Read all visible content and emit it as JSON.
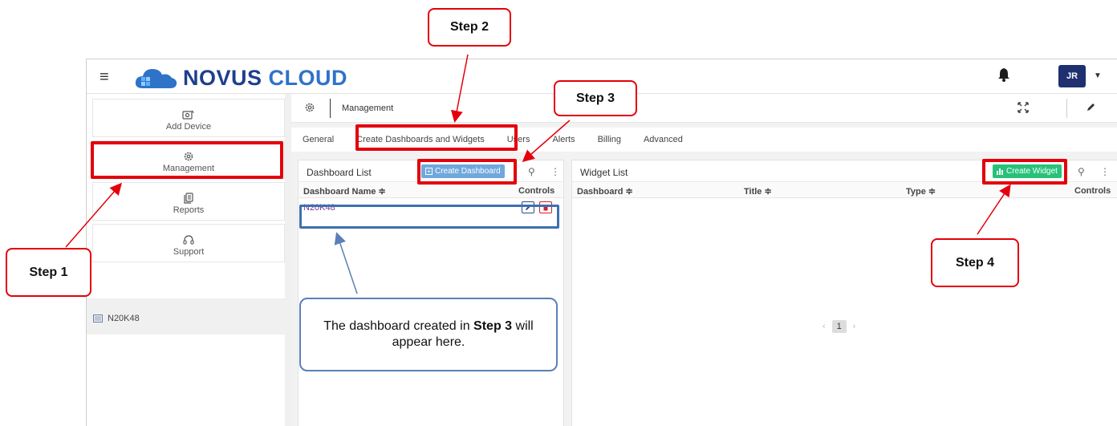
{
  "app": {
    "logo_word1": "novus",
    "logo_word2": "cloud",
    "user_initials": "JR"
  },
  "sidebar": {
    "items": [
      {
        "label": "Add Device",
        "icon": "device-icon"
      },
      {
        "label": "Management",
        "icon": "gear-icon"
      },
      {
        "label": "Reports",
        "icon": "reports-icon"
      },
      {
        "label": "Support",
        "icon": "headset-icon"
      }
    ],
    "device_label": "N20K48"
  },
  "breadcrumb": {
    "title": "Management"
  },
  "tabs": [
    "General",
    "Create Dashboards and Widgets",
    "Users",
    "Alerts",
    "Billing",
    "Advanced"
  ],
  "dashboard_panel": {
    "title": "Dashboard List",
    "create_label": "Create Dashboard",
    "columns": [
      "Dashboard Name ≑",
      "Controls"
    ],
    "rows": [
      {
        "name": "N20K48"
      }
    ]
  },
  "widget_panel": {
    "title": "Widget List",
    "create_label": "Create Widget",
    "columns": [
      "Dashboard ≑",
      "Title ≑",
      "Type ≑",
      "Controls"
    ],
    "pager": {
      "prev": "‹",
      "page": "1",
      "next": "›"
    }
  },
  "annotations": {
    "step1": "Step 1",
    "step2": "Step 2",
    "step3": "Step 3",
    "step4": "Step 4",
    "note_part1": "The dashboard created in ",
    "note_bold": "Step 3",
    "note_part2": " will appear here."
  },
  "colors": {
    "highlight": "#e3000b",
    "create_dashboard": "#6fa8dc",
    "create_widget": "#27c27a",
    "avatar": "#1e3070"
  }
}
